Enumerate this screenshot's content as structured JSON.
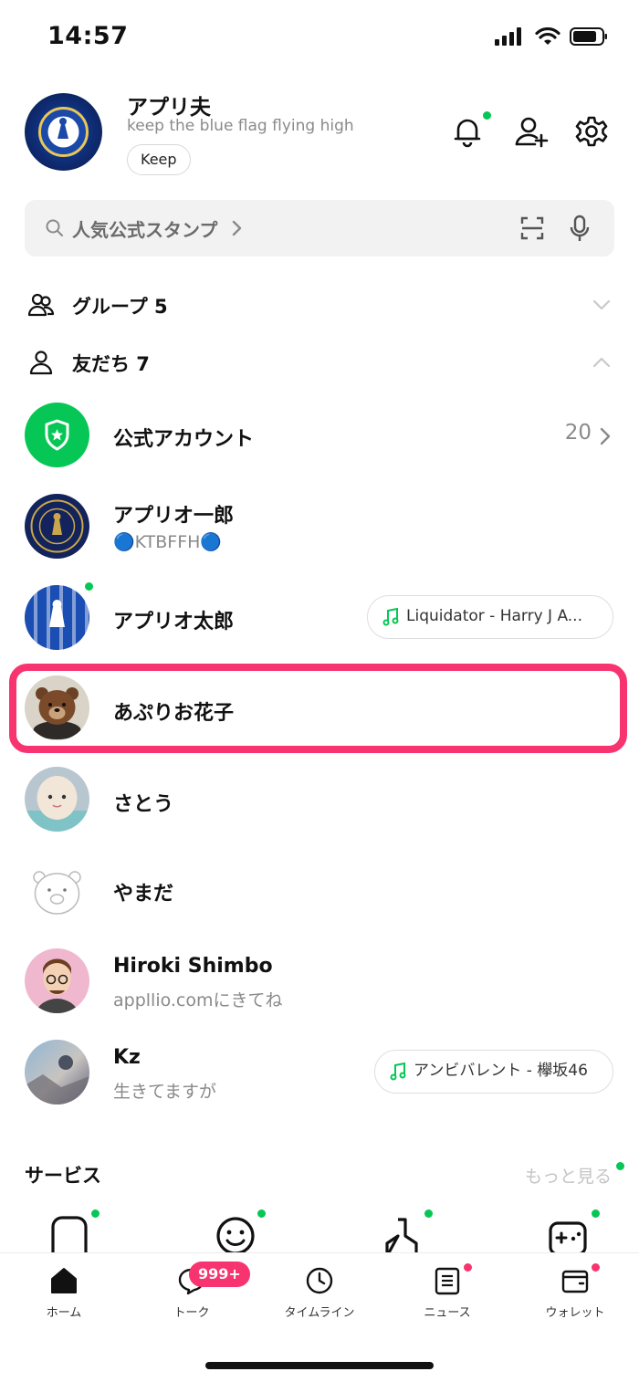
{
  "status_bar": {
    "time": "14:57"
  },
  "profile": {
    "name": "アプリ夫",
    "status_message": "keep the blue flag flying high",
    "keep_label": "Keep"
  },
  "search": {
    "placeholder": "人気公式スタンプ"
  },
  "sections": {
    "groups": "グループ 5",
    "friends": "友だち 7"
  },
  "official": {
    "label": "公式アカウント",
    "count": "20"
  },
  "friends": [
    {
      "name": "アプリオ一郎",
      "sub": "🔵KTBFFH🔵"
    },
    {
      "name": "アプリオ太郎",
      "music": "Liquidator - Harry J A..."
    },
    {
      "name": "あぷりお花子"
    },
    {
      "name": "さとう"
    },
    {
      "name": "やまだ"
    },
    {
      "name": "Hiroki Shimbo",
      "sub": "appllio.comにきてね"
    },
    {
      "name": "Kz",
      "sub": "生きてますが",
      "music": "アンビバレント - 欅坂46"
    }
  ],
  "services": {
    "title": "サービス",
    "more": "もっと見る"
  },
  "tabs": [
    {
      "label": "ホーム"
    },
    {
      "label": "トーク",
      "badge": "999+"
    },
    {
      "label": "タイムライン"
    },
    {
      "label": "ニュース"
    },
    {
      "label": "ウォレット"
    }
  ],
  "colors": {
    "accent_green": "#06c755",
    "highlight": "#f7346f",
    "badge": "#f7346f"
  }
}
